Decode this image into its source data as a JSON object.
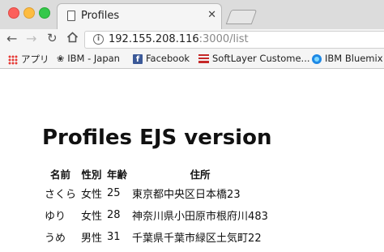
{
  "browser": {
    "tab": {
      "title": "Profiles",
      "close_glyph": "✕"
    },
    "nav_icons": [
      "back-icon",
      "forward-icon",
      "reload-icon",
      "home-icon"
    ],
    "address": {
      "host": "192.155.208.116",
      "rest": ":3000/list"
    },
    "bookmarks": [
      {
        "icon": "apps-icon",
        "label": "アプリ"
      },
      {
        "icon": "ibm-icon",
        "label": "IBM - Japan"
      },
      {
        "icon": "facebook-icon",
        "label": "Facebook"
      },
      {
        "icon": "softlayer-icon",
        "label": "SoftLayer Custome..."
      },
      {
        "icon": "bluemix-icon",
        "label": "IBM Bluemix -"
      }
    ]
  },
  "page": {
    "heading": "Profiles EJS version",
    "table": {
      "headers": [
        "名前",
        "性別",
        "年齢",
        "住所"
      ],
      "rows": [
        [
          "さくら",
          "女性",
          "25",
          "東京都中央区日本橋23"
        ],
        [
          "ゆり",
          "女性",
          "28",
          "神奈川県小田原市根府川483"
        ],
        [
          "うめ",
          "男性",
          "31",
          "千葉県千葉市緑区土気町22"
        ]
      ]
    }
  }
}
